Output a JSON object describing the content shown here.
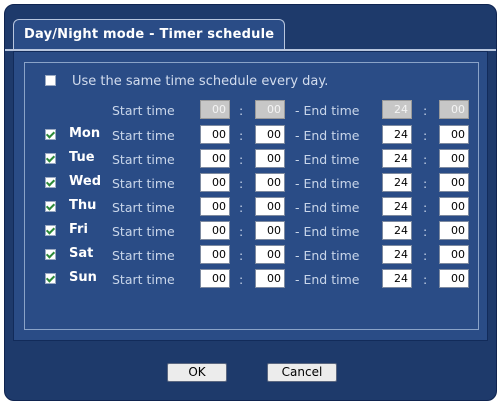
{
  "tab": {
    "label": "Day/Night mode - Timer schedule"
  },
  "same_schedule": {
    "label": "Use the same time schedule every day.",
    "checked": false
  },
  "common": {
    "start_label": "Start time",
    "end_label": "- End time",
    "colon": ":",
    "start_hh": "00",
    "start_mm": "00",
    "end_hh": "24",
    "end_mm": "00"
  },
  "days": [
    {
      "name": "Mon",
      "checked": true,
      "start_label": "Start time",
      "end_label": "- End time",
      "start_hh": "00",
      "start_mm": "00",
      "end_hh": "24",
      "end_mm": "00"
    },
    {
      "name": "Tue",
      "checked": true,
      "start_label": "Start time",
      "end_label": "- End time",
      "start_hh": "00",
      "start_mm": "00",
      "end_hh": "24",
      "end_mm": "00"
    },
    {
      "name": "Wed",
      "checked": true,
      "start_label": "Start time",
      "end_label": "- End time",
      "start_hh": "00",
      "start_mm": "00",
      "end_hh": "24",
      "end_mm": "00"
    },
    {
      "name": "Thu",
      "checked": true,
      "start_label": "Start time",
      "end_label": "- End time",
      "start_hh": "00",
      "start_mm": "00",
      "end_hh": "24",
      "end_mm": "00"
    },
    {
      "name": "Fri",
      "checked": true,
      "start_label": "Start time",
      "end_label": "- End time",
      "start_hh": "00",
      "start_mm": "00",
      "end_hh": "24",
      "end_mm": "00"
    },
    {
      "name": "Sat",
      "checked": true,
      "start_label": "Start time",
      "end_label": "- End time",
      "start_hh": "00",
      "start_mm": "00",
      "end_hh": "24",
      "end_mm": "00"
    },
    {
      "name": "Sun",
      "checked": true,
      "start_label": "Start time",
      "end_label": "- End time",
      "start_hh": "00",
      "start_mm": "00",
      "end_hh": "24",
      "end_mm": "00"
    }
  ],
  "buttons": {
    "ok": "OK",
    "cancel": "Cancel"
  },
  "colors": {
    "dialog_bg": "#1e3a6b",
    "panel_bg": "#2a4c86",
    "check_color": "#2e8a3a"
  }
}
